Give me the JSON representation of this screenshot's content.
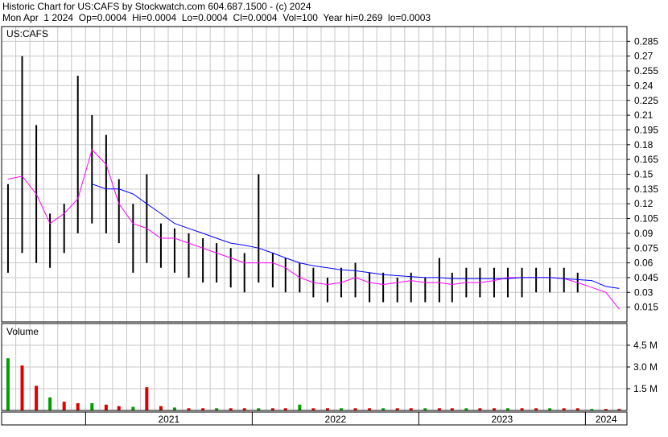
{
  "header": {
    "line1": "Historic Chart for US:CAFS by Stockwatch.com 604.687.1500 - (c) 2024",
    "line2": "Mon Apr  1 2024  Op=0.0004  Hi=0.0004  Lo=0.0004  Cl=0.0004  Vol=100  Year hi=0.269  lo=0.0003"
  },
  "colors": {
    "background": "#ffffff",
    "grid": "#c8c8c8",
    "price_bars": "#000000",
    "last_price_marks": "#ff0000",
    "ma_short": "#ff00ff",
    "ma_long": "#0000ff",
    "volume_up": "#00a000",
    "volume_down": "#e00000"
  },
  "chart_data": [
    {
      "type": "line",
      "label": "US:CAFS",
      "ylim": [
        0,
        0.3
      ],
      "y_ticks": [
        "0.285",
        "0.27",
        "0.255",
        "0.24",
        "0.225",
        "0.21",
        "0.195",
        "0.18",
        "0.165",
        "0.15",
        "0.135",
        "0.12",
        "0.105",
        "0.09",
        "0.075",
        "0.06",
        "0.045",
        "0.03",
        "0.015"
      ],
      "x_labels": [
        "2021",
        "2022",
        "2023",
        "2024"
      ],
      "grid": true,
      "series": [
        {
          "style": "high-low bars",
          "color": "#000000",
          "x": [
            "2020-07",
            "2020-08",
            "2020-09",
            "2020-10",
            "2020-11",
            "2020-12",
            "2021-01",
            "2021-02",
            "2021-03",
            "2021-04",
            "2021-05",
            "2021-06",
            "2021-07",
            "2021-08",
            "2021-09",
            "2021-10",
            "2021-11",
            "2021-12",
            "2022-01",
            "2022-02",
            "2022-03",
            "2022-04",
            "2022-05",
            "2022-06",
            "2022-07",
            "2022-08",
            "2022-09",
            "2022-10",
            "2022-11",
            "2022-12",
            "2023-01",
            "2023-02",
            "2023-03",
            "2023-04",
            "2023-05",
            "2023-06",
            "2023-07",
            "2023-08",
            "2023-09",
            "2023-10",
            "2023-11",
            "2023-12"
          ],
          "high": [
            0.14,
            0.27,
            0.2,
            0.11,
            0.12,
            0.25,
            0.21,
            0.19,
            0.145,
            0.12,
            0.15,
            0.1,
            0.095,
            0.09,
            0.085,
            0.08,
            0.075,
            0.07,
            0.15,
            0.07,
            0.065,
            0.06,
            0.055,
            0.045,
            0.055,
            0.06,
            0.05,
            0.05,
            0.045,
            0.05,
            0.045,
            0.065,
            0.05,
            0.055,
            0.055,
            0.055,
            0.055,
            0.055,
            0.055,
            0.055,
            0.055,
            0.05
          ],
          "low": [
            0.05,
            0.07,
            0.06,
            0.055,
            0.07,
            0.09,
            0.1,
            0.09,
            0.08,
            0.05,
            0.06,
            0.055,
            0.05,
            0.045,
            0.04,
            0.04,
            0.035,
            0.03,
            0.04,
            0.035,
            0.03,
            0.03,
            0.025,
            0.02,
            0.025,
            0.025,
            0.02,
            0.02,
            0.02,
            0.02,
            0.02,
            0.02,
            0.02,
            0.025,
            0.025,
            0.025,
            0.025,
            0.025,
            0.03,
            0.03,
            0.03,
            0.03
          ]
        },
        {
          "style": "moving average",
          "color": "#ff00ff",
          "x": [
            "2020-07",
            "2020-08",
            "2020-09",
            "2020-10",
            "2020-11",
            "2020-12",
            "2021-01",
            "2021-02",
            "2021-03",
            "2021-04",
            "2021-05",
            "2021-06",
            "2021-07",
            "2021-08",
            "2021-09",
            "2021-10",
            "2021-11",
            "2021-12",
            "2022-01",
            "2022-02",
            "2022-03",
            "2022-04",
            "2022-05",
            "2022-06",
            "2022-07",
            "2022-08",
            "2022-09",
            "2022-10",
            "2022-11",
            "2022-12",
            "2023-01",
            "2023-02",
            "2023-03",
            "2023-04",
            "2023-05",
            "2023-06",
            "2023-07",
            "2023-08",
            "2023-09",
            "2023-10",
            "2023-11",
            "2023-12",
            "2024-01",
            "2024-02",
            "2024-03"
          ],
          "values": [
            0.145,
            0.148,
            0.13,
            0.1,
            0.11,
            0.125,
            0.175,
            0.16,
            0.12,
            0.1,
            0.095,
            0.085,
            0.085,
            0.08,
            0.075,
            0.07,
            0.065,
            0.06,
            0.06,
            0.06,
            0.055,
            0.045,
            0.04,
            0.038,
            0.04,
            0.045,
            0.04,
            0.038,
            0.04,
            0.042,
            0.04,
            0.04,
            0.038,
            0.04,
            0.04,
            0.042,
            0.045,
            0.045,
            0.045,
            0.045,
            0.044,
            0.04,
            0.035,
            0.03,
            0.013
          ]
        },
        {
          "style": "moving average",
          "color": "#0000ff",
          "x": [
            "2021-01",
            "2021-02",
            "2021-03",
            "2021-04",
            "2021-05",
            "2021-06",
            "2021-07",
            "2021-08",
            "2021-09",
            "2021-10",
            "2021-11",
            "2021-12",
            "2022-01",
            "2022-02",
            "2022-03",
            "2022-04",
            "2022-05",
            "2022-06",
            "2022-07",
            "2022-08",
            "2022-09",
            "2022-10",
            "2022-11",
            "2022-12",
            "2023-01",
            "2023-02",
            "2023-03",
            "2023-04",
            "2023-05",
            "2023-06",
            "2023-07",
            "2023-08",
            "2023-09",
            "2023-10",
            "2023-11",
            "2023-12",
            "2024-01",
            "2024-02",
            "2024-03"
          ],
          "values": [
            0.14,
            0.135,
            0.135,
            0.13,
            0.12,
            0.11,
            0.1,
            0.095,
            0.09,
            0.085,
            0.08,
            0.078,
            0.075,
            0.07,
            0.065,
            0.06,
            0.057,
            0.055,
            0.053,
            0.052,
            0.05,
            0.048,
            0.047,
            0.046,
            0.045,
            0.045,
            0.044,
            0.044,
            0.044,
            0.044,
            0.044,
            0.045,
            0.045,
            0.045,
            0.044,
            0.043,
            0.042,
            0.036,
            0.034
          ]
        }
      ]
    },
    {
      "type": "bar",
      "label": "Volume",
      "ylim": [
        0,
        6000000
      ],
      "y_ticks": [
        "4.5 M",
        "3.0 M",
        "1.5 M"
      ],
      "x_labels": [
        "2021",
        "2022",
        "2023",
        "2024"
      ],
      "grid": true,
      "x": [
        "2020-07",
        "2020-08",
        "2020-09",
        "2020-10",
        "2020-11",
        "2020-12",
        "2021-01",
        "2021-02",
        "2021-03",
        "2021-04",
        "2021-05",
        "2021-06",
        "2021-07",
        "2021-08",
        "2021-09",
        "2021-10",
        "2021-11",
        "2021-12",
        "2022-01",
        "2022-02",
        "2022-03",
        "2022-04",
        "2022-05",
        "2022-06",
        "2022-07",
        "2022-08",
        "2022-09",
        "2022-10",
        "2022-11",
        "2022-12",
        "2023-01",
        "2023-02",
        "2023-03",
        "2023-04",
        "2023-05",
        "2023-06",
        "2023-07",
        "2023-08",
        "2023-09",
        "2023-10",
        "2023-11",
        "2023-12",
        "2024-01",
        "2024-02",
        "2024-03"
      ],
      "values": [
        3600000,
        3100000,
        1700000,
        900000,
        600000,
        500000,
        500000,
        400000,
        300000,
        250000,
        1600000,
        300000,
        200000,
        150000,
        150000,
        150000,
        150000,
        150000,
        150000,
        150000,
        150000,
        400000,
        150000,
        150000,
        150000,
        150000,
        150000,
        150000,
        150000,
        150000,
        150000,
        150000,
        150000,
        150000,
        150000,
        150000,
        150000,
        150000,
        150000,
        150000,
        150000,
        150000,
        100000,
        100000,
        100000
      ]
    }
  ]
}
